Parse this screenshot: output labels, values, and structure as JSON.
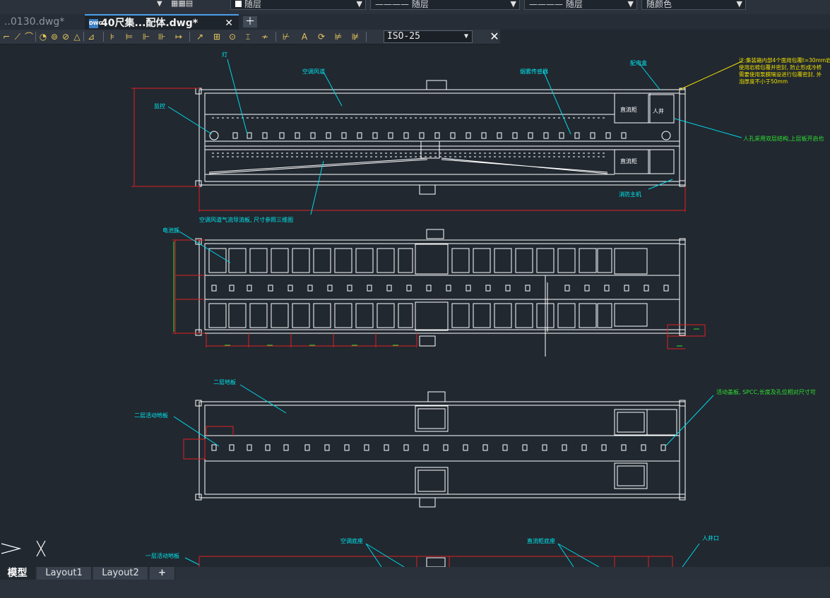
{
  "toolbar": {
    "layer_dropdowns": [
      {
        "value": "随层"
      },
      {
        "value": "———— 随层"
      },
      {
        "value": "———— 随层"
      },
      {
        "value": "随颜色"
      }
    ]
  },
  "tabs": [
    {
      "label": "..0130.dwg*"
    },
    {
      "label": "40尺集...配体.dwg*"
    }
  ],
  "dim_toolbar": {
    "dim_style": "ISO-25"
  },
  "annotations": {
    "light": "灯",
    "ac_duct": "空调风道",
    "smoke_detector": "烟雾传感器",
    "dist_box": "配电盒",
    "note_lines": [
      "注:集装箱内部4个面用包覆t=30mm岩棉",
      "使用岩棉包覆并密封, 防止形成冷桥",
      "需要使用泵膜隔设进行包覆密封, 外",
      "泡厚度不小于50mm"
    ],
    "monitor": "监控",
    "dc_cabinet_1": "直流柜",
    "manhole_1": "人井",
    "manhole_note": "人孔采用双层结构,上层板开启也",
    "dc_cabinet_2": "直流柜",
    "fire_host": "消防主机",
    "duct_note": "空调风道气流导流板, 尺寸参照三维图",
    "battery": "电池簇",
    "second_floor": "二层地板",
    "second_floor_move": "二层活动地板",
    "move_plate_note": "活动盖板, SPCC,长度及孔位相对尺寸可",
    "first_floor_move": "一层活动地板",
    "ac_base": "空调底座",
    "dc_base": "直流柜底座",
    "manhole_mouth": "人井口"
  },
  "layout_tabs": [
    {
      "label": "模型"
    },
    {
      "label": "Layout1"
    },
    {
      "label": "Layout2"
    },
    {
      "label": "+"
    }
  ],
  "colors": {
    "background": "#212830",
    "geometry": "#ffffff",
    "leader": "#00d8e8",
    "dimension": "#e02020",
    "text_cyan": "#00e8f0",
    "text_yellow": "#f0e000",
    "text_green": "#30e030"
  }
}
